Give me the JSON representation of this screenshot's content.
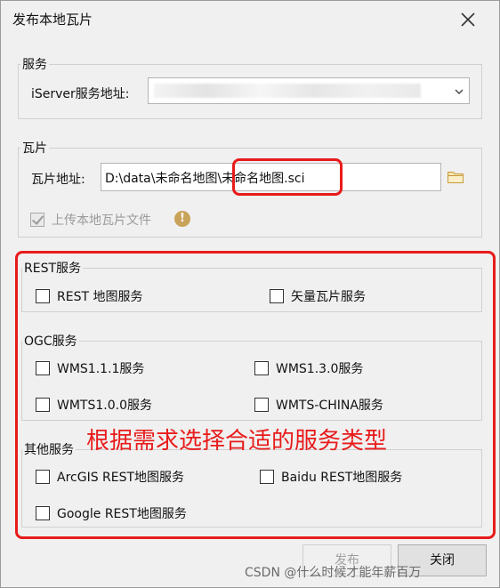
{
  "window": {
    "title": "发布本地瓦片"
  },
  "service_group": {
    "legend": "服务",
    "address_label": "iServer服务地址:",
    "address_value": ""
  },
  "tile_group": {
    "legend": "瓦片",
    "address_label": "瓦片地址:",
    "address_value": "D:\\data\\未命名地图\\未命名地图.sci",
    "upload_label": "上传本地瓦片文件",
    "upload_checked": true
  },
  "rest_group": {
    "legend": "REST服务",
    "items": [
      "REST 地图服务",
      "矢量瓦片服务"
    ]
  },
  "ogc_group": {
    "legend": "OGC服务",
    "items": [
      "WMS1.1.1服务",
      "WMS1.3.0服务",
      "WMTS1.0.0服务",
      "WMTS-CHINA服务"
    ]
  },
  "other_group": {
    "legend": "其他服务",
    "items": [
      "ArcGIS REST地图服务",
      "Baidu REST地图服务",
      "Google REST地图服务"
    ]
  },
  "annotation": "根据需求选择合适的服务类型",
  "buttons": {
    "publish": "发布",
    "close": "关闭"
  },
  "watermark": "CSDN @什么时候才能年薪百万",
  "colors": {
    "highlight_red": "#e81b1b",
    "dialog_bg": "#f0f0f0"
  }
}
